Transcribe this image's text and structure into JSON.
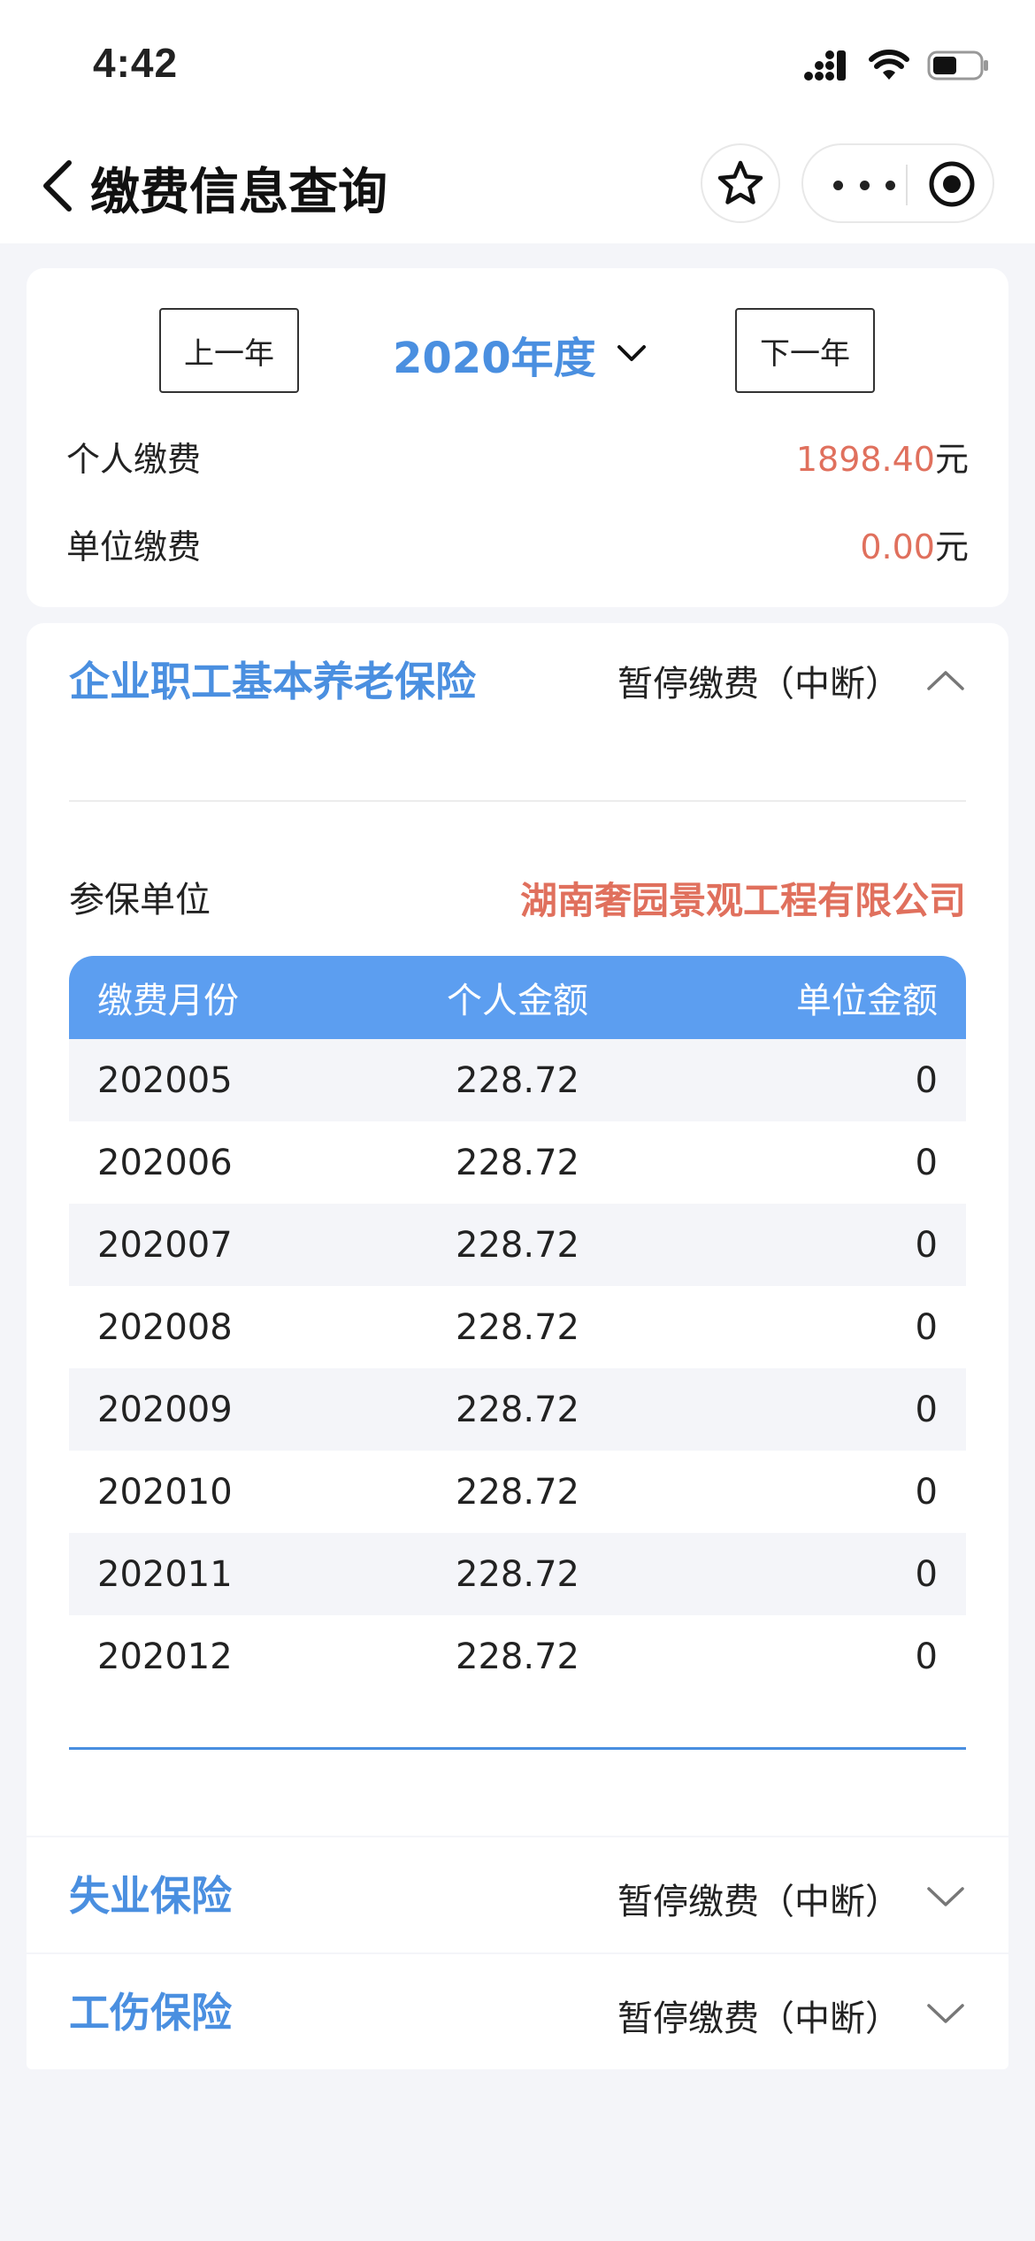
{
  "status_bar": {
    "time": "4:42",
    "icons": [
      "cellular-signal-icon",
      "wifi-icon",
      "battery-icon"
    ]
  },
  "nav": {
    "title": "缴费信息查询",
    "icons": [
      "back-chevron-icon",
      "star-icon",
      "more-dots-icon",
      "record-target-icon"
    ]
  },
  "summary": {
    "prev_year_label": "上一年",
    "next_year_label": "下一年",
    "year_label": "2020年度",
    "personal_label": "个人缴费",
    "personal_value": "1898.40",
    "personal_unit": "元",
    "unit_label": "单位缴费",
    "unit_value": "0.00",
    "unit_unit": "元"
  },
  "pension": {
    "title": "企业职工基本养老保险",
    "status": "暂停缴费（中断）",
    "expanded": true,
    "employer_label": "参保单位",
    "employer_name": "湖南奢园景观工程有限公司",
    "columns": [
      "缴费月份",
      "个人金额",
      "单位金额"
    ],
    "rows": [
      [
        "202005",
        "228.72",
        "0"
      ],
      [
        "202006",
        "228.72",
        "0"
      ],
      [
        "202007",
        "228.72",
        "0"
      ],
      [
        "202008",
        "228.72",
        "0"
      ],
      [
        "202009",
        "228.72",
        "0"
      ],
      [
        "202010",
        "228.72",
        "0"
      ],
      [
        "202011",
        "228.72",
        "0"
      ],
      [
        "202012",
        "228.72",
        "0"
      ]
    ]
  },
  "unemployment": {
    "title": "失业保险",
    "status": "暂停缴费（中断）",
    "expanded": false
  },
  "injury": {
    "title": "工伤保险",
    "status": "暂停缴费（中断）",
    "expanded": false
  },
  "colors": {
    "accent_blue": "#4a8fe0",
    "table_header": "#5c9ef0",
    "amount_red": "#e0705d",
    "background": "#f4f5f9"
  }
}
